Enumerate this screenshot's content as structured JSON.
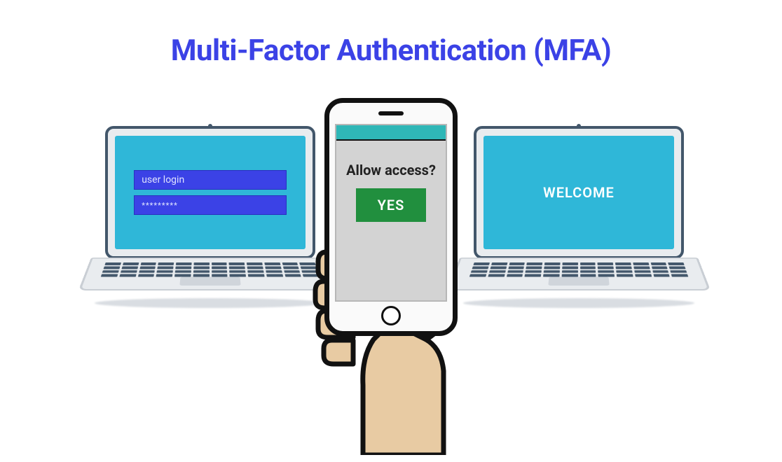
{
  "title": "Multi-Factor Authentication (MFA)",
  "laptop_left": {
    "username_field": "user login",
    "password_field": "*********"
  },
  "laptop_right": {
    "welcome": "WELCOME"
  },
  "phone": {
    "prompt": "Allow access?",
    "yes_label": "YES"
  }
}
